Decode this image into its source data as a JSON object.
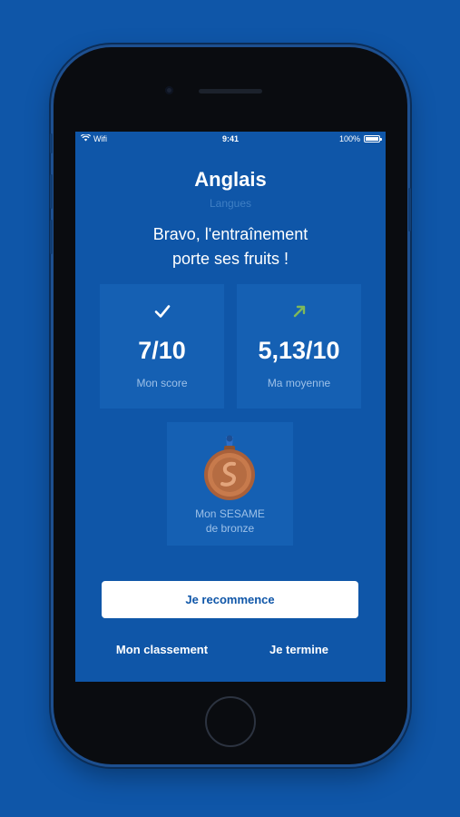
{
  "status_bar": {
    "carrier": "Wifi",
    "time": "9:41",
    "battery": "100%"
  },
  "header": {
    "title": "Anglais",
    "subtitle": "Langues",
    "message_line1": "Bravo, l'entraînement",
    "message_line2": "porte ses fruits !"
  },
  "stats": {
    "score": {
      "icon": "check-icon",
      "value": "7/10",
      "label": "Mon score"
    },
    "average": {
      "icon": "arrow-up-right-icon",
      "value": "5,13/10",
      "label": "Ma moyenne"
    }
  },
  "medal": {
    "icon": "bronze-medal-icon",
    "label_line1": "Mon SESAME",
    "label_line2": "de bronze"
  },
  "actions": {
    "restart_label": "Je recommence",
    "ranking_label": "Mon classement",
    "finish_label": "Je termine"
  },
  "colors": {
    "background": "#0f56a8",
    "card": "#1560b3",
    "accent_green": "#7fb85a",
    "bronze": "#c77a4c"
  }
}
